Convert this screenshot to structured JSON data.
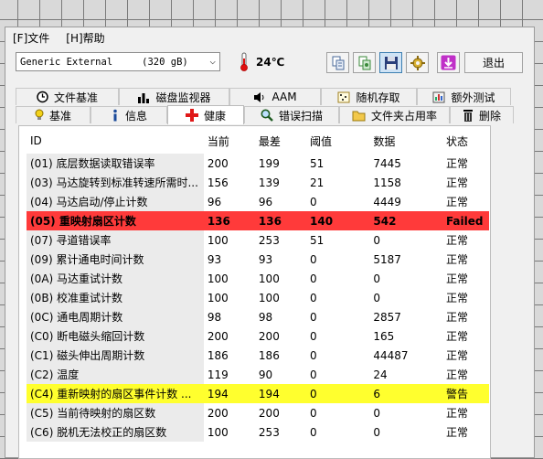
{
  "menu": {
    "file": "[F]文件",
    "help": "[H]帮助"
  },
  "toolbar": {
    "drive": "Generic External",
    "drive_size": "(320 gB)",
    "temperature": "24℃",
    "exit_label": "退出"
  },
  "tabs_row1": [
    "文件基准",
    "磁盘监视器",
    "AAM",
    "随机存取",
    "额外测试"
  ],
  "tabs_row2": [
    "基准",
    "信息",
    "健康",
    "错误扫描",
    "文件夹占用率",
    "删除"
  ],
  "selected_tab": "健康",
  "table": {
    "headers": [
      "ID",
      "当前",
      "最差",
      "阈值",
      "数据",
      "状态"
    ],
    "rows": [
      [
        "(01) 底层数据读取错误率",
        "200",
        "199",
        "51",
        "7445",
        "正常"
      ],
      [
        "(03) 马达旋转到标准转速所需时...",
        "156",
        "139",
        "21",
        "1158",
        "正常"
      ],
      [
        "(04) 马达启动/停止计数",
        "96",
        "96",
        "0",
        "4449",
        "正常"
      ],
      [
        "(05) 重映射扇区计数",
        "136",
        "136",
        "140",
        "542",
        "Failed"
      ],
      [
        "(07) 寻道错误率",
        "100",
        "253",
        "51",
        "0",
        "正常"
      ],
      [
        "(09) 累计通电时间计数",
        "93",
        "93",
        "0",
        "5187",
        "正常"
      ],
      [
        "(0A) 马达重试计数",
        "100",
        "100",
        "0",
        "0",
        "正常"
      ],
      [
        "(0B) 校准重试计数",
        "100",
        "100",
        "0",
        "0",
        "正常"
      ],
      [
        "(0C) 通电周期计数",
        "98",
        "98",
        "0",
        "2857",
        "正常"
      ],
      [
        "(C0) 断电磁头缩回计数",
        "200",
        "200",
        "0",
        "165",
        "正常"
      ],
      [
        "(C1) 磁头伸出周期计数",
        "186",
        "186",
        "0",
        "44487",
        "正常"
      ],
      [
        "(C2) 温度",
        "119",
        "90",
        "0",
        "24",
        "正常"
      ],
      [
        "(C4) 重新映射的扇区事件计数 ...",
        "194",
        "194",
        "0",
        "6",
        "警告"
      ],
      [
        "(C5) 当前待映射的扇区数",
        "200",
        "200",
        "0",
        "0",
        "正常"
      ],
      [
        "(C6) 脱机无法校正的扇区数",
        "100",
        "253",
        "0",
        "0",
        "正常"
      ]
    ],
    "row_highlights": {
      "3": "red",
      "12": "yellow"
    }
  },
  "colors": {
    "failed_row": "#ff3a3a",
    "warning_row": "#ffff2e"
  }
}
